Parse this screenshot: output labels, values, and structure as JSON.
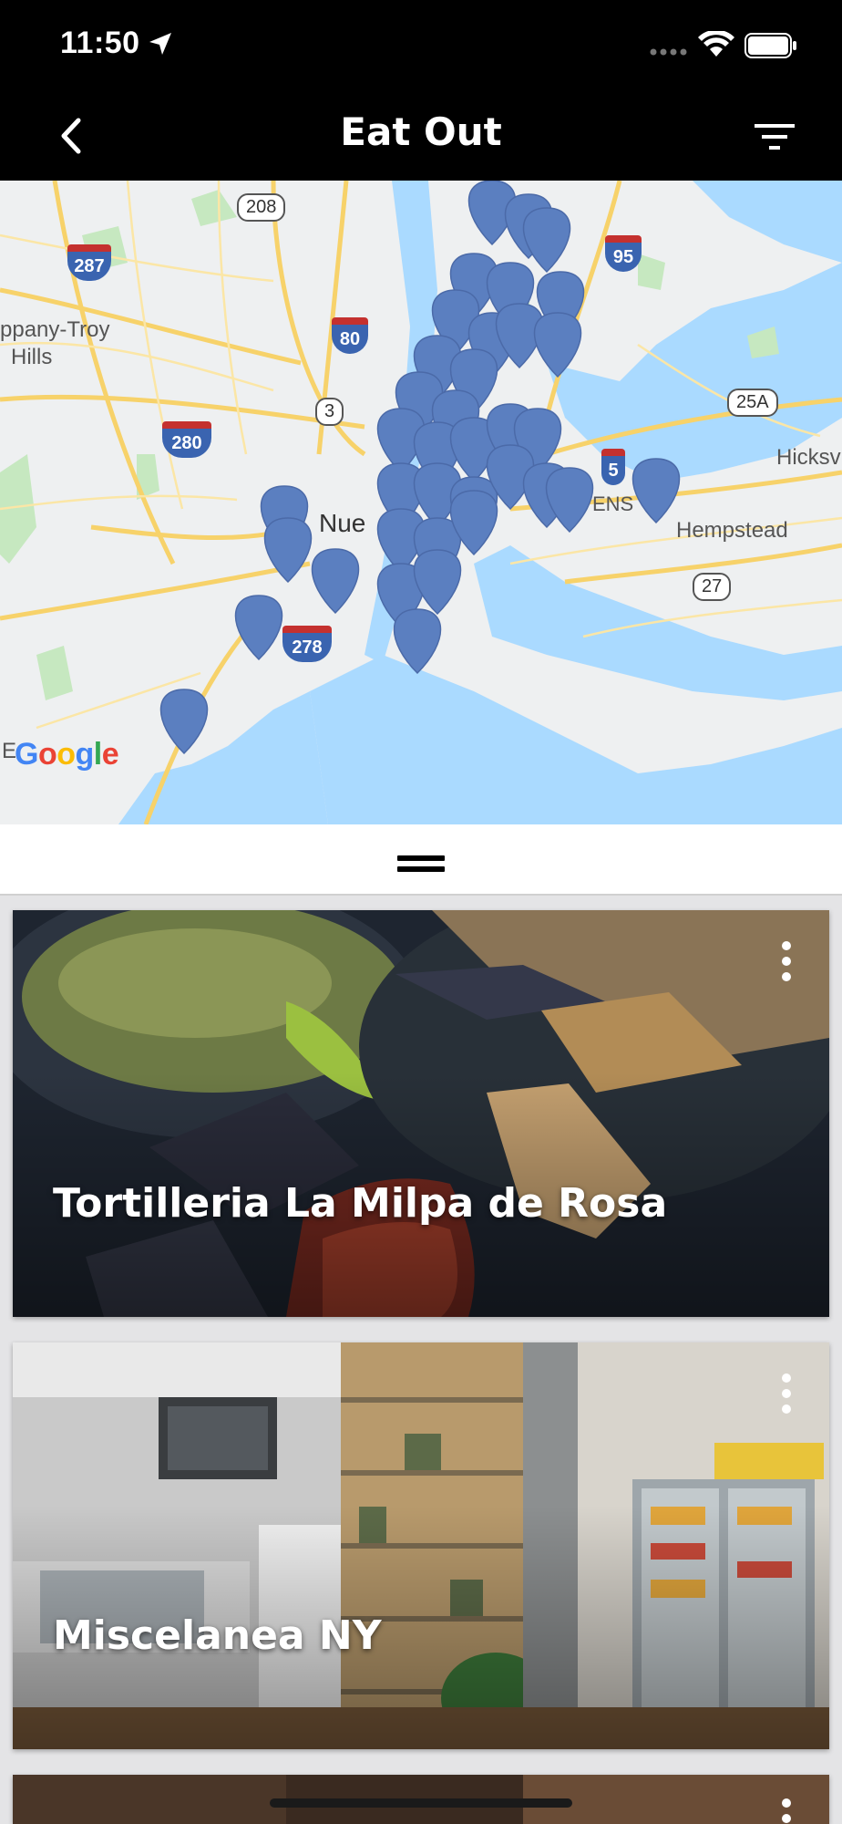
{
  "status_bar": {
    "time": "11:50"
  },
  "nav": {
    "title": "Eat Out"
  },
  "map": {
    "labels": {
      "parsippany": "ppany-Troy",
      "hills": "Hills",
      "newark_partial": "Nue",
      "queens_partial": "ENS",
      "hempstead": "Hempstead",
      "hicksville_partial": "Hicksv",
      "elizabeth_partial": "E"
    },
    "routes": {
      "r208": "208",
      "r287": "287",
      "r80": "80",
      "r3": "3",
      "r280": "280",
      "r278": "278",
      "r95": "95",
      "r25a": "25A",
      "r27": "27",
      "r495_partial": "5"
    },
    "attribution": "Google",
    "pin_color": "#5b7fc0"
  },
  "restaurants": [
    {
      "name": "Tortilleria La Milpa de Rosa"
    },
    {
      "name": "Miscelanea NY"
    },
    {
      "name": ""
    }
  ]
}
